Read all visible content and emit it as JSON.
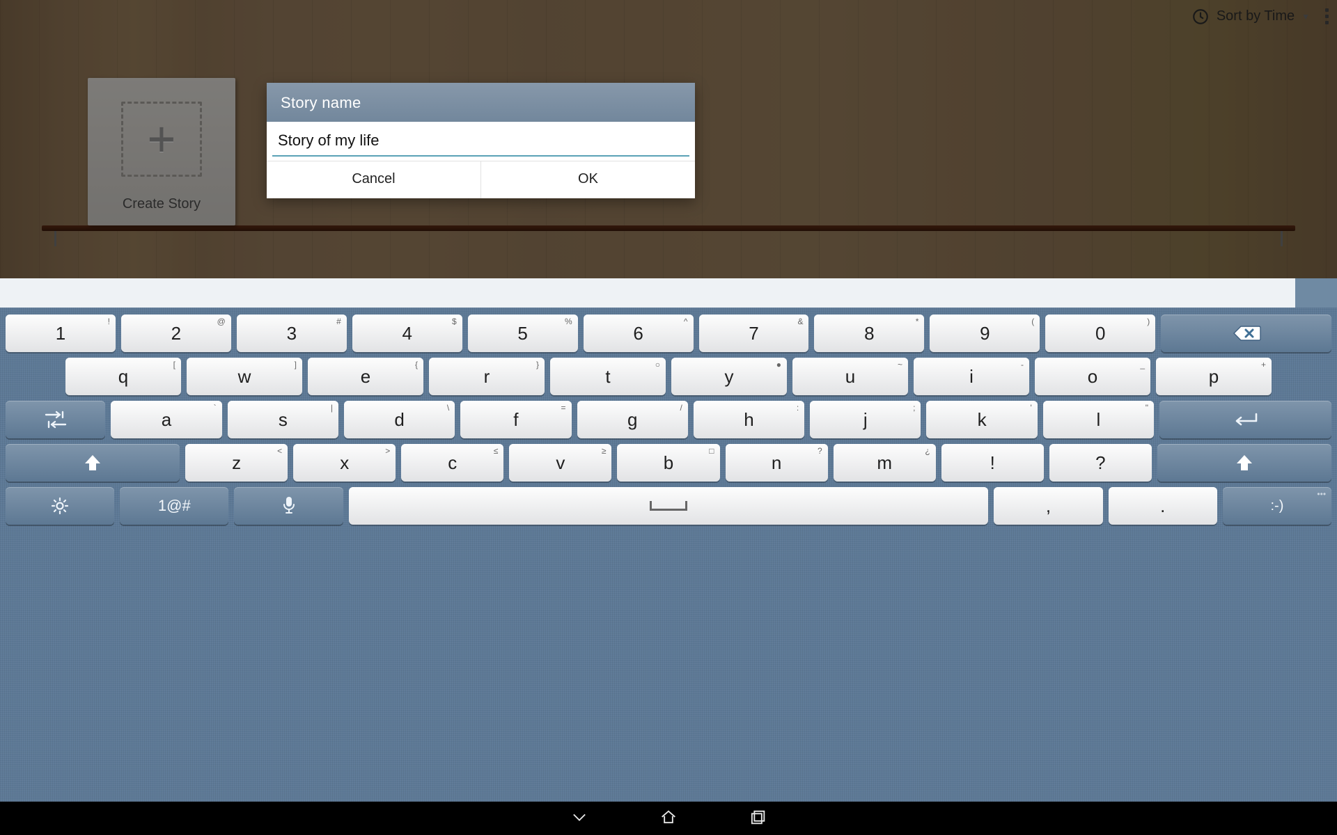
{
  "topbar": {
    "sort_label": "Sort by Time"
  },
  "card": {
    "label": "Create Story"
  },
  "dialog": {
    "title": "Story name",
    "input_value": "Story of my life",
    "cancel": "Cancel",
    "ok": "OK"
  },
  "keyboard": {
    "row1": [
      {
        "main": "1",
        "sup": "!"
      },
      {
        "main": "2",
        "sup": "@"
      },
      {
        "main": "3",
        "sup": "#"
      },
      {
        "main": "4",
        "sup": "$"
      },
      {
        "main": "5",
        "sup": "%"
      },
      {
        "main": "6",
        "sup": "^"
      },
      {
        "main": "7",
        "sup": "&"
      },
      {
        "main": "8",
        "sup": "*"
      },
      {
        "main": "9",
        "sup": "("
      },
      {
        "main": "0",
        "sup": ")"
      }
    ],
    "row2": [
      {
        "main": "q",
        "sup": "["
      },
      {
        "main": "w",
        "sup": "]"
      },
      {
        "main": "e",
        "sup": "{"
      },
      {
        "main": "r",
        "sup": "}"
      },
      {
        "main": "t",
        "sup": "○"
      },
      {
        "main": "y",
        "sup": "●"
      },
      {
        "main": "u",
        "sup": "~"
      },
      {
        "main": "i",
        "sup": "-"
      },
      {
        "main": "o",
        "sup": "_"
      },
      {
        "main": "p",
        "sup": "+"
      }
    ],
    "row3": [
      {
        "main": "a",
        "sup": "`"
      },
      {
        "main": "s",
        "sup": "|"
      },
      {
        "main": "d",
        "sup": "\\"
      },
      {
        "main": "f",
        "sup": "="
      },
      {
        "main": "g",
        "sup": "/"
      },
      {
        "main": "h",
        "sup": ":"
      },
      {
        "main": "j",
        "sup": ";"
      },
      {
        "main": "k",
        "sup": "'"
      },
      {
        "main": "l",
        "sup": "\""
      }
    ],
    "row4": [
      {
        "main": "z",
        "sup": "<"
      },
      {
        "main": "x",
        "sup": ">"
      },
      {
        "main": "c",
        "sup": "≤"
      },
      {
        "main": "v",
        "sup": "≥"
      },
      {
        "main": "b",
        "sup": "□"
      },
      {
        "main": "n",
        "sup": "?"
      },
      {
        "main": "m",
        "sup": "¿"
      },
      {
        "main": "!",
        "sup": ""
      },
      {
        "main": "?",
        "sup": ""
      }
    ],
    "row5": {
      "symbols": "1@#",
      "comma": ",",
      "period": ".",
      "emoji": ":-)",
      "emoji_sup": "•••"
    }
  }
}
